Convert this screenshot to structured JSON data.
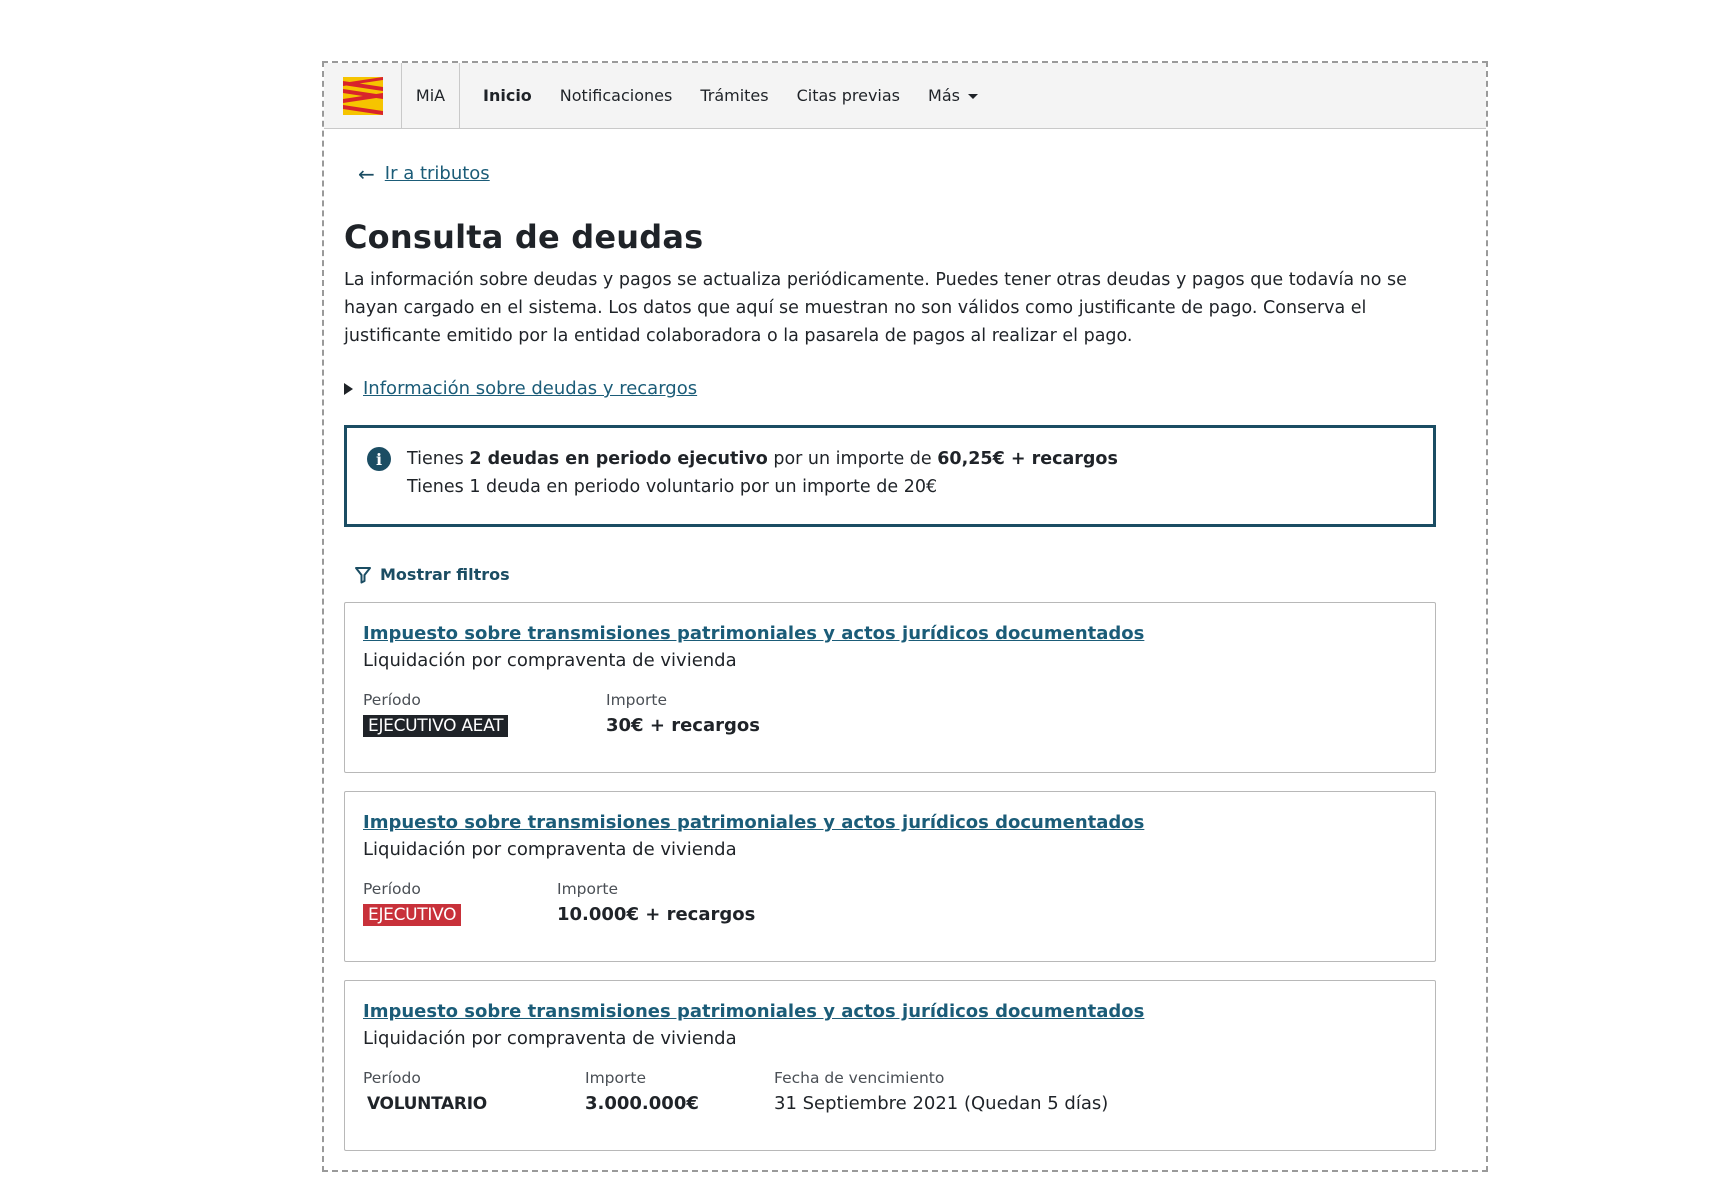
{
  "nav": {
    "mia": "MiA",
    "links": [
      "Inicio",
      "Notificaciones",
      "Trámites",
      "Citas previas"
    ],
    "more": "Más"
  },
  "back_link": "Ir a tributos",
  "title": "Consulta de deudas",
  "intro": "La información sobre deudas y pagos se actualiza periódicamente. Puedes tener otras deudas y pagos que todavía no se hayan cargado en el sistema. Los datos que aquí se muestran no son válidos como justificante de pago. Conserva el justificante emitido por la entidad colaboradora o la pasarela de pagos al realizar el pago.",
  "details_link": "Información sobre deudas y recargos",
  "info": {
    "line1_prefix": "Tienes ",
    "line1_bold1": "2 deudas en periodo ejecutivo",
    "line1_mid": " por un importe de ",
    "line1_bold2": "60,25€ + recargos",
    "line2": "Tienes 1 deuda en periodo voluntario por un importe de 20€"
  },
  "filters_label": "Mostrar filtros",
  "debts": [
    {
      "title": "Impuesto sobre transmisiones patrimoniales y actos jurídicos documentados",
      "subtitle": "Liquidación por compraventa de vivienda",
      "period_label": "Período",
      "period": "EJECUTIVO AEAT",
      "amount_label": "Importe",
      "amount": "30€ + recargos"
    },
    {
      "title": "Impuesto sobre transmisiones patrimoniales y actos jurídicos documentados",
      "subtitle": "Liquidación por compraventa de vivienda",
      "period_label": "Período",
      "period": "EJECUTIVO",
      "amount_label": "Importe",
      "amount": "10.000€ + recargos"
    },
    {
      "title": "Impuesto sobre transmisiones patrimoniales y actos jurídicos documentados",
      "subtitle": "Liquidación por compraventa de vivienda",
      "period_label": "Período",
      "period": "VOLUNTARIO",
      "amount_label": "Importe",
      "amount": "3.000.000€",
      "due_label": "Fecha de vencimiento",
      "due": "31 Septiembre 2021 (Quedan 5 días)"
    }
  ],
  "colors": {
    "brand": "#1b4d63",
    "link": "#1b5c78",
    "badge_dark": "#1f2328",
    "badge_red": "#c8313a"
  }
}
